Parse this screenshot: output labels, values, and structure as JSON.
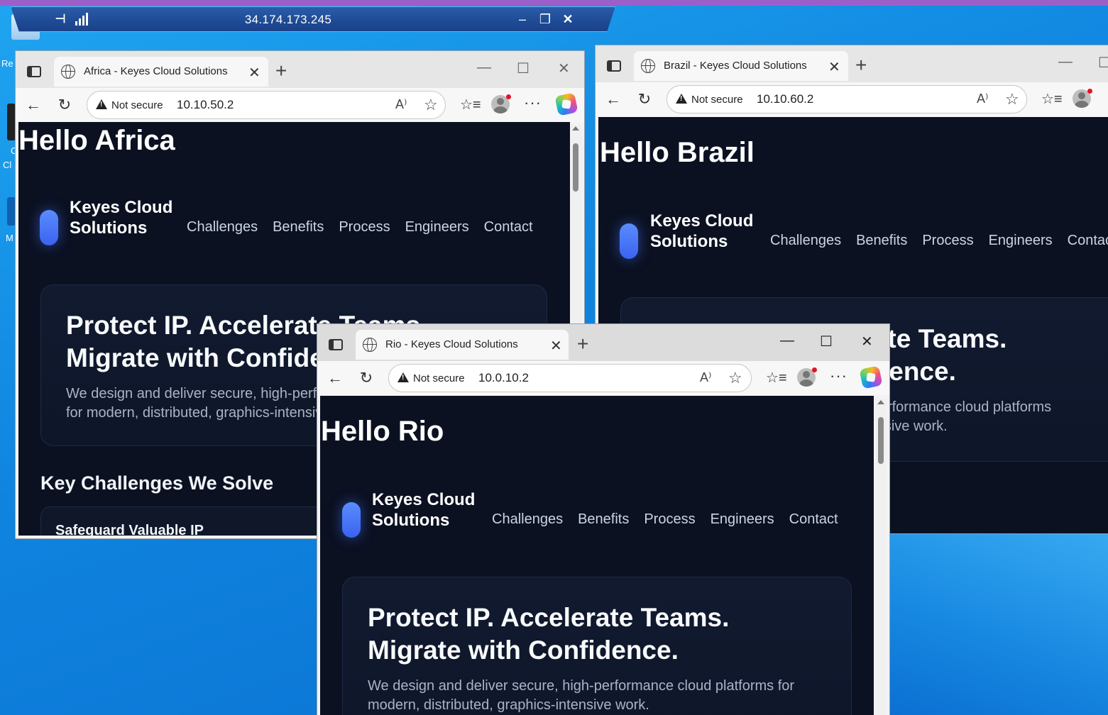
{
  "rdp": {
    "address": "34.174.173.245",
    "pin_glyph": "⊣",
    "min": "‒",
    "restore": "❐",
    "close": "✕"
  },
  "desktop": {
    "labels": [
      "Re",
      "C",
      "Cl",
      "M"
    ]
  },
  "windows": {
    "africa": {
      "tab_title": "Africa - Keyes Cloud Solutions",
      "security": "Not secure",
      "url": "10.10.50.2",
      "hello": "Hello Africa",
      "brand": "Keyes Cloud Solutions",
      "nav": [
        "Challenges",
        "Benefits",
        "Process",
        "Engineers",
        "Contact"
      ],
      "hero_title_1": "Protect IP. Accelerate Teams.",
      "hero_title_2": "Migrate with Confidence.",
      "hero_text_1": "We design and deliver secure, high-performance cloud platforms for",
      "hero_text_2": "for modern, distributed, graphics-intensive work.",
      "section_title": "Key Challenges We Solve",
      "card_title": "Safeguard Valuable IP"
    },
    "brazil": {
      "tab_title": "Brazil - Keyes Cloud Solutions",
      "security": "Not secure",
      "url": "10.10.60.2",
      "hello": "Hello Brazil",
      "brand": "Keyes Cloud Solutions",
      "nav": [
        "Challenges",
        "Benefits",
        "Process",
        "Engineers",
        "Contact"
      ],
      "hero_title_1": "Protect IP. Accelerate Teams.",
      "hero_title_2": "Migrate with Confidence.",
      "hero_text_1": "We design and deliver secure, high-performance cloud platforms",
      "hero_text_2": "for modern, distributed, graphics-intensive work."
    },
    "rio": {
      "tab_title": "Rio - Keyes Cloud Solutions",
      "security": "Not secure",
      "url": "10.0.10.2",
      "hello": "Hello Rio",
      "brand": "Keyes Cloud Solutions",
      "nav": [
        "Challenges",
        "Benefits",
        "Process",
        "Engineers",
        "Contact"
      ],
      "hero_title_1": "Protect IP. Accelerate Teams.",
      "hero_title_2": "Migrate with Confidence.",
      "hero_text_1": "We design and deliver secure, high-performance cloud platforms for",
      "hero_text_2": "modern, distributed, graphics-intensive work."
    }
  },
  "icons": {
    "tab_close": "✕",
    "new_tab": "+",
    "minimize": "—",
    "maximize": "☐",
    "close": "✕",
    "back": "←",
    "refresh": "↻",
    "read_aloud": "A⁾",
    "favorite": "☆",
    "favorites": "☆≡",
    "more": "···"
  },
  "colors": {
    "page_bg": "#0b1121",
    "accent": "#3a63ef",
    "desktop": "#1a8fe0",
    "rdp_bar": "#1f4c96"
  }
}
